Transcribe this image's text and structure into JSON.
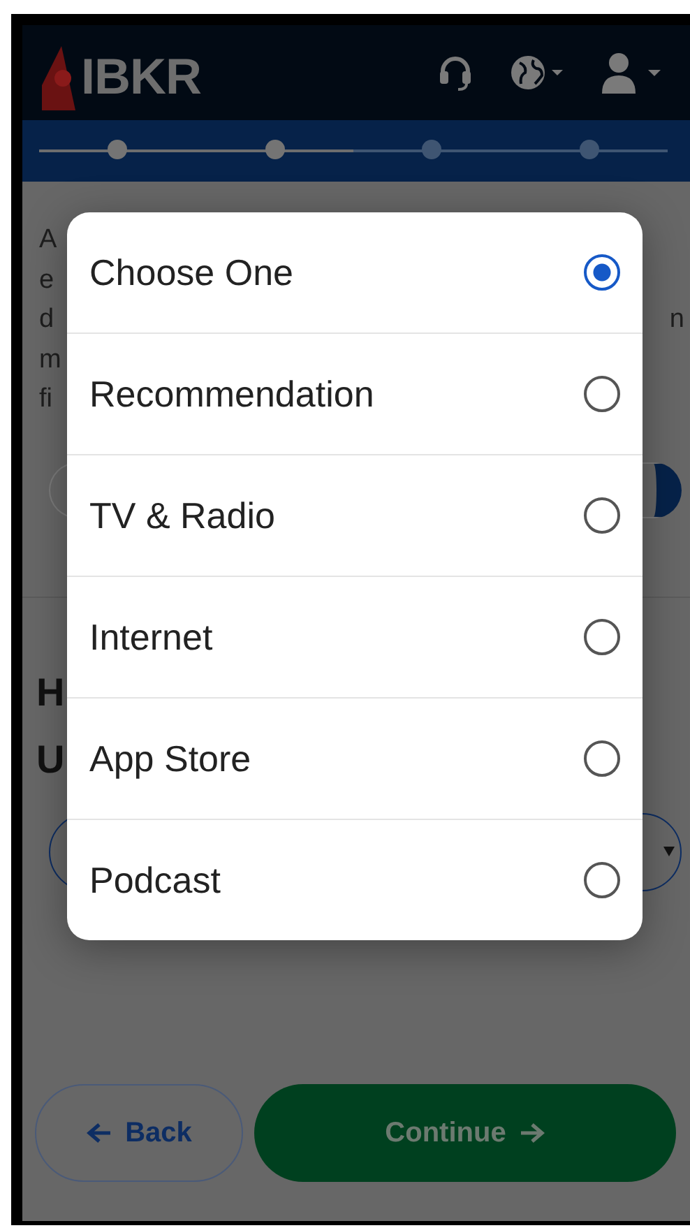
{
  "header": {
    "logo": "IBKR"
  },
  "progress": {
    "level": 0.5,
    "steps": [
      {
        "done": true
      },
      {
        "done": true
      },
      {
        "done": false
      },
      {
        "done": false
      }
    ]
  },
  "background": {
    "paragraph_lines": [
      {
        "left": "A"
      },
      {
        "left": "e"
      },
      {
        "left": "d",
        "right": "n"
      },
      {
        "left": "m"
      },
      {
        "left": "fi"
      }
    ],
    "heading_lines": [
      "H",
      "U"
    ]
  },
  "buttons": [
    {
      "kind": "back",
      "label": "Back",
      "disabled": false
    },
    {
      "kind": "continue",
      "label": "Continue",
      "disabled": true
    }
  ],
  "dialog": {
    "options": [
      {
        "label": "Choose One",
        "selected": true
      },
      {
        "label": "Recommendation",
        "selected": false
      },
      {
        "label": "TV & Radio",
        "selected": false
      },
      {
        "label": "Internet",
        "selected": false
      },
      {
        "label": "App Store",
        "selected": false
      },
      {
        "label": "Podcast",
        "selected": false
      }
    ]
  }
}
